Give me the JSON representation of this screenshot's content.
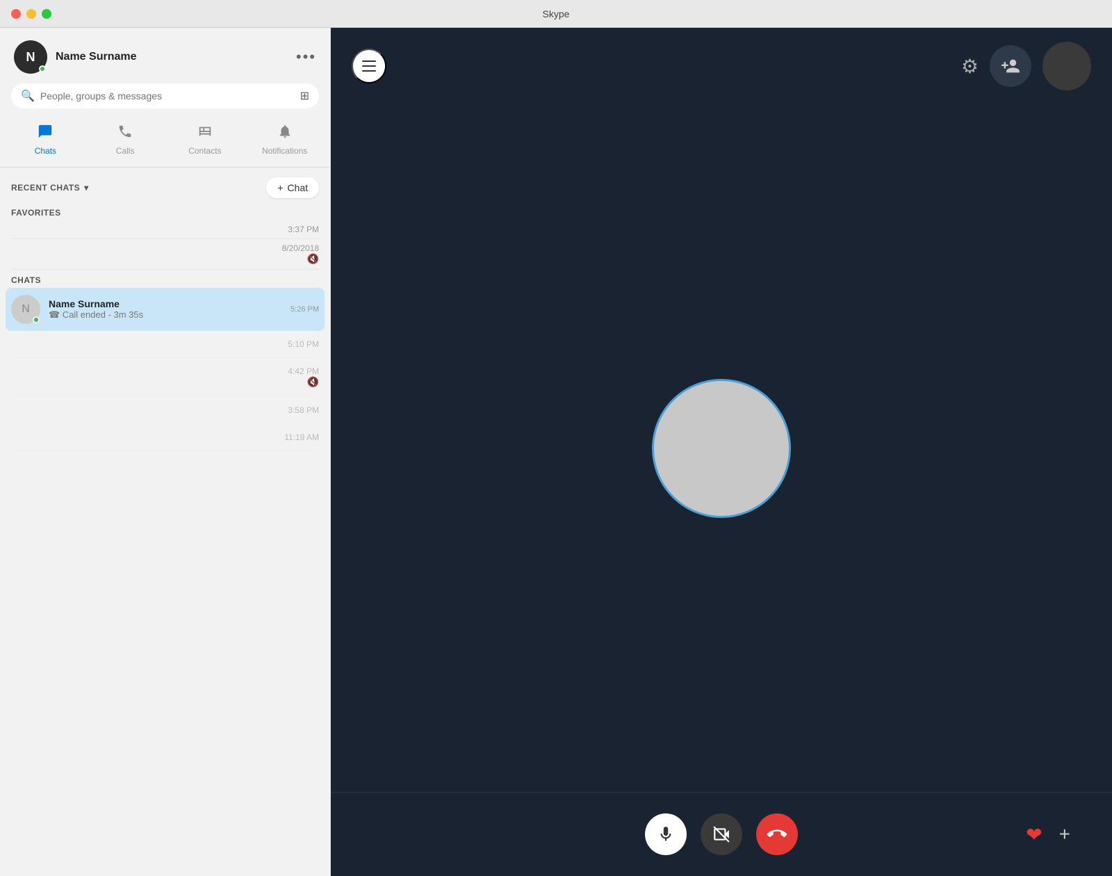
{
  "titleBar": {
    "title": "Skype"
  },
  "sidebar": {
    "profile": {
      "name": "Name Surname",
      "initials": "N",
      "status": "online"
    },
    "more_label": "•••",
    "search": {
      "placeholder": "People, groups & messages"
    },
    "nav": {
      "tabs": [
        {
          "id": "chats",
          "label": "Chats",
          "icon": "💬",
          "active": true
        },
        {
          "id": "calls",
          "label": "Calls",
          "icon": "📞",
          "active": false
        },
        {
          "id": "contacts",
          "label": "Contacts",
          "icon": "👤",
          "active": false
        },
        {
          "id": "notifications",
          "label": "Notifications",
          "icon": "🔔",
          "active": false
        }
      ]
    },
    "recentChats": {
      "label": "RECENT CHATS",
      "chevron": "▾",
      "newChat": "+ Chat"
    },
    "favorites": {
      "label": "FAVORITES",
      "items": [
        {
          "time": "3:37 PM"
        },
        {
          "time": "8/20/2018",
          "muted": true
        }
      ]
    },
    "chats": {
      "label": "CHATS",
      "items": [
        {
          "name": "Name Surname",
          "preview": "☎ Call ended - 3m 35s",
          "time": "5:26 PM",
          "active": true,
          "online": true
        }
      ],
      "placeholders": [
        {
          "time": "5:10 PM"
        },
        {
          "time": "4:42 PM",
          "muted": true
        },
        {
          "time": "3:58 PM"
        },
        {
          "time": "11:19 AM"
        }
      ]
    }
  },
  "main": {
    "menuBtn": "☰",
    "gearLabel": "⚙",
    "addPersonLabel": "👤+",
    "controls": {
      "mic": "🎤",
      "camera_off": "📷",
      "end_call": "📵",
      "heart": "❤",
      "plus": "+"
    }
  }
}
